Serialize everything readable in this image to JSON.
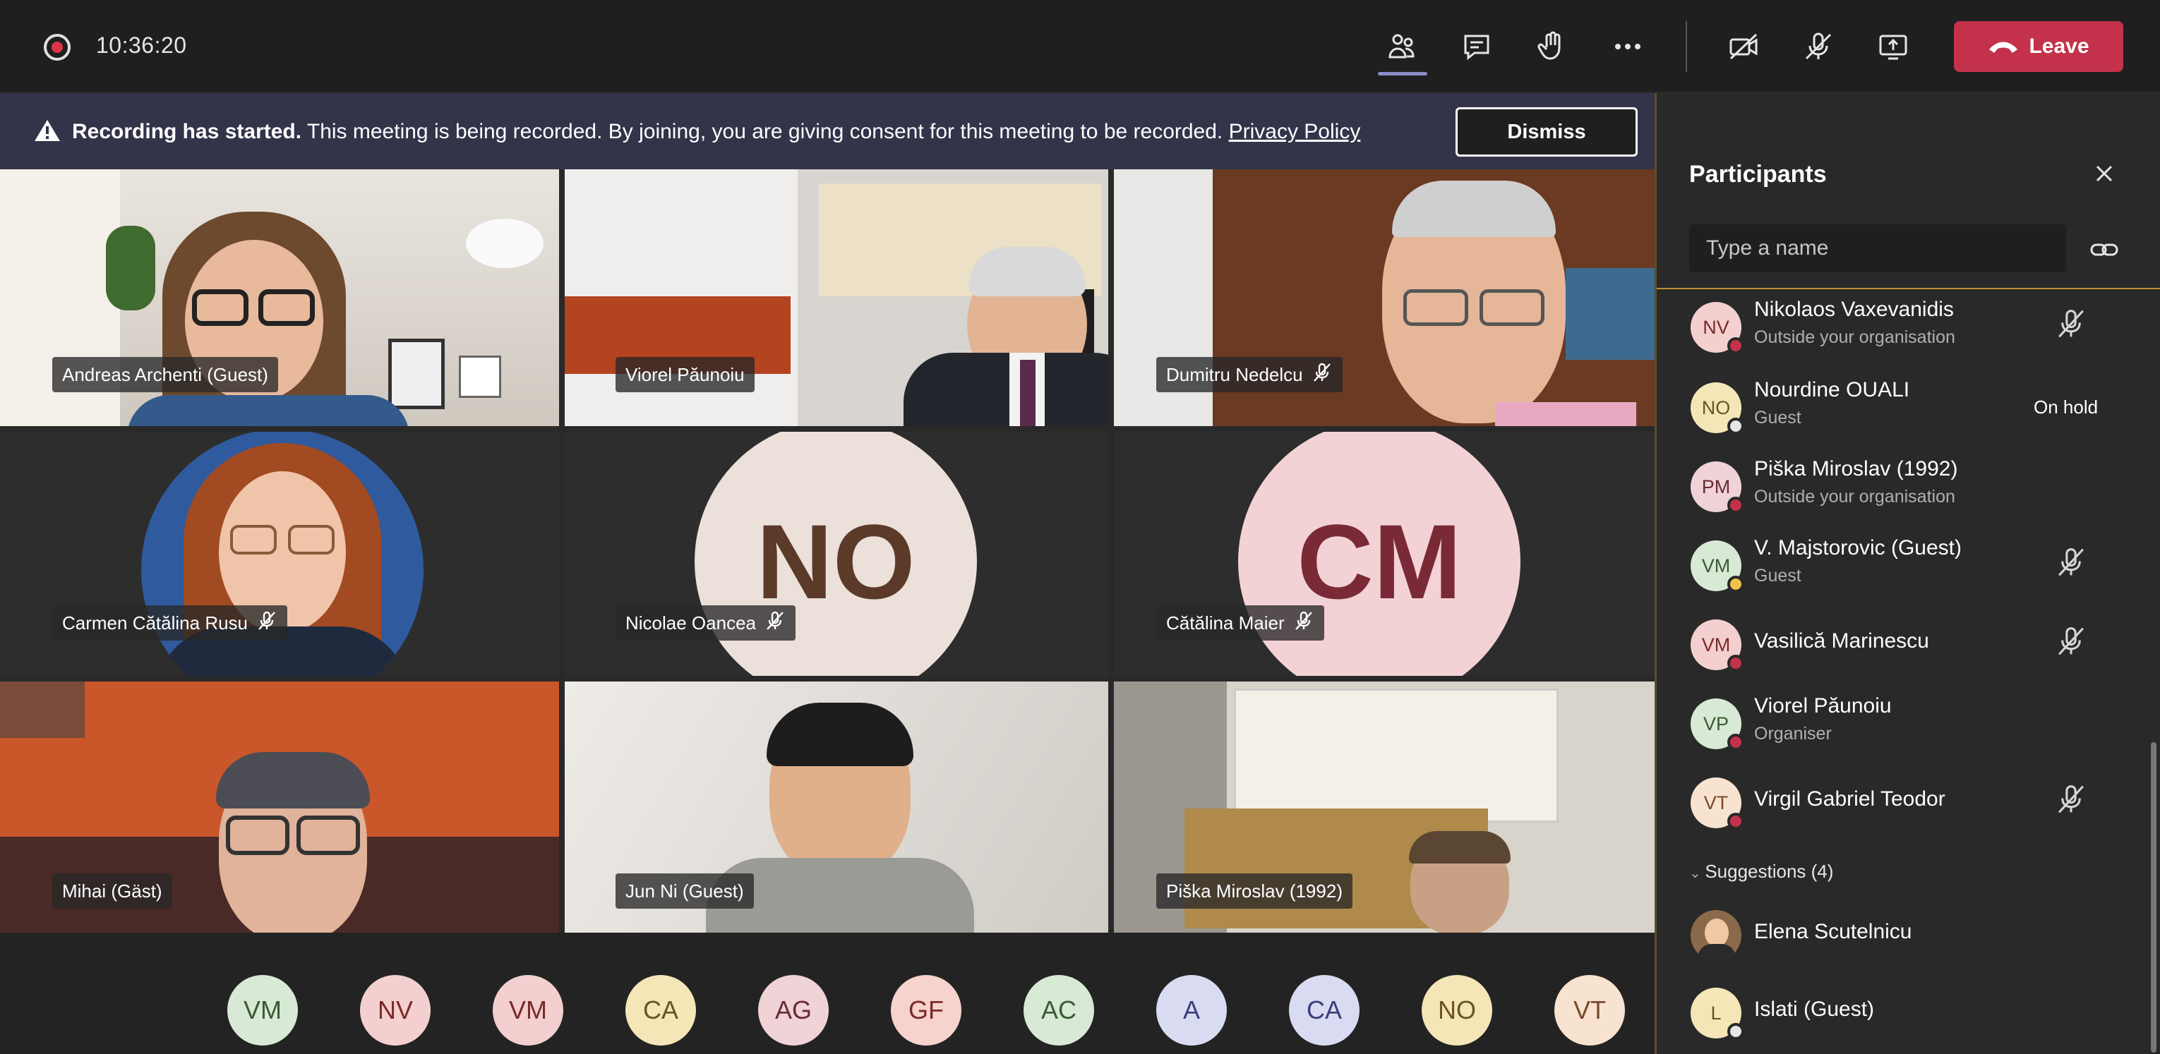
{
  "topbar": {
    "timer": "10:36:20",
    "icons": [
      "participants-icon",
      "chat-icon",
      "raise-hand-icon",
      "more-icon",
      "camera-off-icon",
      "mic-off-icon",
      "share-screen-icon"
    ],
    "leave_label": "Leave",
    "accent": "#c4314b"
  },
  "banner": {
    "bold": "Recording has started.",
    "text": "This meeting is being recorded. By joining, you are giving consent for this meeting to be recorded.",
    "link": "Privacy Policy",
    "dismiss_label": "Dismiss"
  },
  "tiles": [
    {
      "name": "Andreas Archenti (Guest)",
      "muted": false
    },
    {
      "name": "Viorel Păunoiu",
      "muted": false
    },
    {
      "name": "Dumitru Nedelcu",
      "muted": true
    },
    {
      "name": "Carmen Cătălina Rusu",
      "muted": true
    },
    {
      "name": "Nicolae Oancea",
      "muted": true,
      "initials": "NO"
    },
    {
      "name": "Cătălina Maier",
      "muted": true,
      "initials": "CM"
    },
    {
      "name": "Mihai (Gäst)",
      "muted": false
    },
    {
      "name": "Jun Ni (Guest)",
      "muted": false
    },
    {
      "name": "Piška Miroslav (1992)",
      "muted": false
    }
  ],
  "strip": [
    "VM",
    "NV",
    "VM",
    "CA",
    "AG",
    "GF",
    "AC",
    "A",
    "CA",
    "NO",
    "VT"
  ],
  "sidebar": {
    "title": "Participants",
    "search_placeholder": "Type a name",
    "participants": [
      {
        "initials": "NV",
        "name": "Nikolaos Vaxevanidis",
        "sub": "Outside your organisation",
        "muted": true,
        "extra": ""
      },
      {
        "initials": "NO",
        "name": "Nourdine OUALI",
        "sub": "Guest",
        "muted": false,
        "extra": "On hold"
      },
      {
        "initials": "PM",
        "name": "Piška Miroslav (1992)",
        "sub": "Outside your organisation",
        "muted": false,
        "extra": ""
      },
      {
        "initials": "VM",
        "name": "V. Majstorovic (Guest)",
        "sub": "Guest",
        "muted": true,
        "extra": ""
      },
      {
        "initials": "VM",
        "name": "Vasilică Marinescu",
        "sub": "",
        "muted": true,
        "extra": ""
      },
      {
        "initials": "VP",
        "name": "Viorel Păunoiu",
        "sub": "Organiser",
        "muted": false,
        "extra": ""
      },
      {
        "initials": "VT",
        "name": "Virgil Gabriel Teodor",
        "sub": "",
        "muted": true,
        "extra": ""
      }
    ],
    "suggestions_label": "Suggestions (4)",
    "suggestions": [
      {
        "initials": "",
        "name": "Elena Scutelnicu"
      },
      {
        "initials": "L",
        "name": "Islati (Guest)"
      }
    ]
  }
}
